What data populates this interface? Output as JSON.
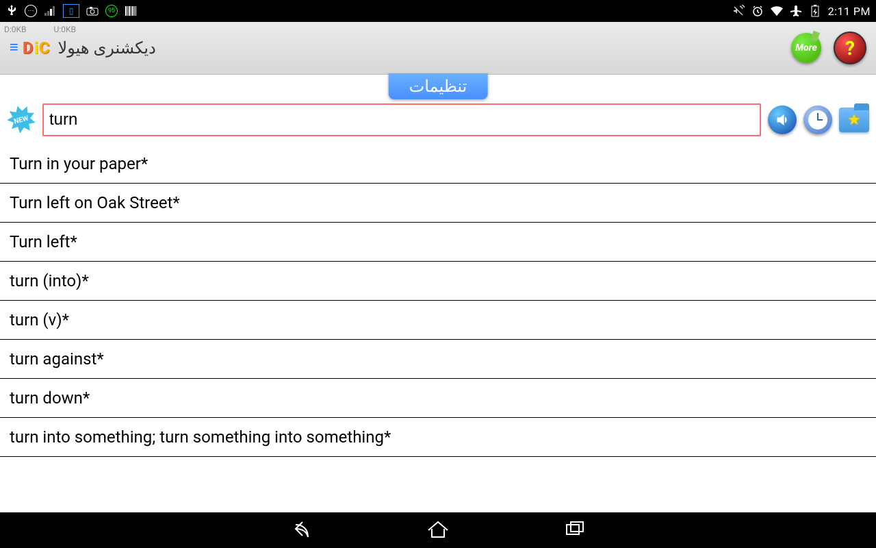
{
  "statusbar": {
    "d_label": "D:0KB",
    "u_label": "U:0KB",
    "badge_num": "95",
    "time": "2:11 PM"
  },
  "toolbar": {
    "app_title": "دیکشنری هیولا",
    "more_label": "More"
  },
  "settings_button": "تنظیمات",
  "new_badge": "NEW",
  "search": {
    "value": "turn",
    "placeholder": ""
  },
  "results": [
    "Turn in your paper*",
    "Turn left on Oak Street*",
    "Turn left*",
    "turn (into)*",
    "turn (v)*",
    "turn against*",
    "turn down*",
    "turn into something; turn something into something*"
  ]
}
